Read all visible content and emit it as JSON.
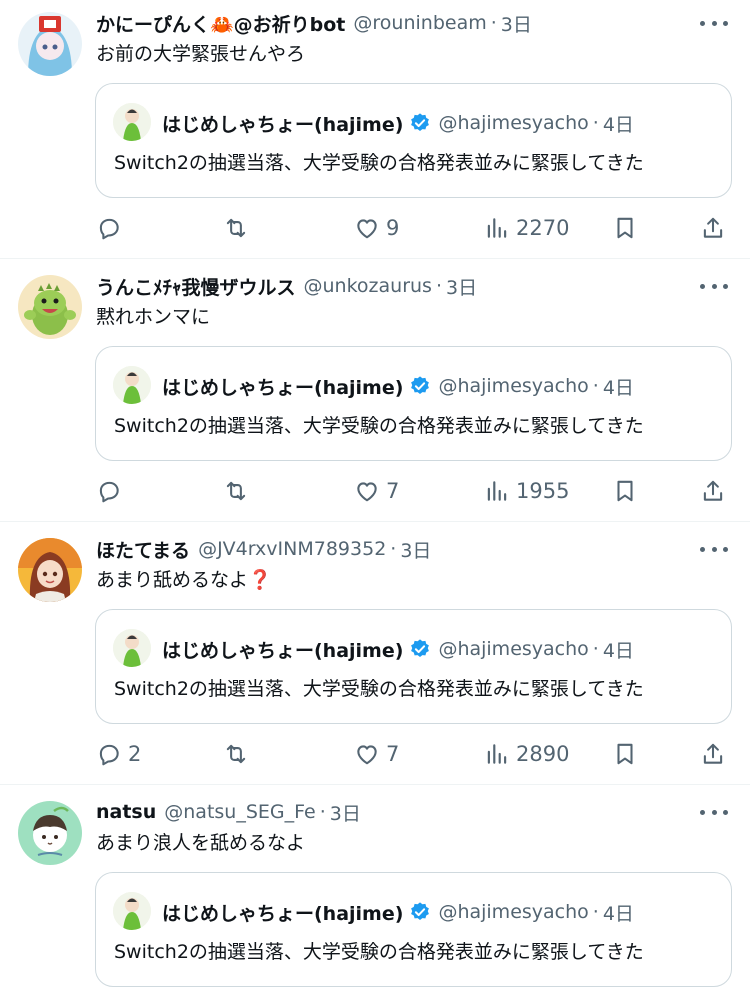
{
  "posts": [
    {
      "author": "かにーぴんく🦀@お祈りbot",
      "handle": "@rouninbeam",
      "time": "3日",
      "text": "お前の大学緊張せんやろ",
      "quote": {
        "author": "はじめしゃちょー(hajime)",
        "handle": "@hajimesyacho",
        "time": "4日",
        "text": "Switch2の抽選当落、大学受験の合格発表並みに緊張してきた"
      },
      "replies": "",
      "likes": "9",
      "views": "2270"
    },
    {
      "author": "うんこﾒﾁｬ我慢ザウルス",
      "handle": "@unkozaurus",
      "time": "3日",
      "text": "黙れホンマに",
      "quote": {
        "author": "はじめしゃちょー(hajime)",
        "handle": "@hajimesyacho",
        "time": "4日",
        "text": "Switch2の抽選当落、大学受験の合格発表並みに緊張してきた"
      },
      "replies": "",
      "likes": "7",
      "views": "1955"
    },
    {
      "author": "ほたてまる",
      "handle": "@JV4rxvINM789352",
      "time": "3日",
      "text": "あまり舐めるなよ❓",
      "quote": {
        "author": "はじめしゃちょー(hajime)",
        "handle": "@hajimesyacho",
        "time": "4日",
        "text": "Switch2の抽選当落、大学受験の合格発表並みに緊張してきた"
      },
      "replies": "2",
      "likes": "7",
      "views": "2890"
    },
    {
      "author": "natsu",
      "handle": "@natsu_SEG_Fe",
      "time": "3日",
      "text": "あまり浪人を舐めるなよ",
      "quote": {
        "author": "はじめしゃちょー(hajime)",
        "handle": "@hajimesyacho",
        "time": "4日",
        "text": "Switch2の抽選当落、大学受験の合格発表並みに緊張してきた"
      }
    }
  ],
  "separator": "·",
  "icons": {
    "reply": "reply-icon",
    "repost": "repost-icon",
    "like": "like-icon",
    "views": "views-icon",
    "bookmark": "bookmark-icon",
    "share": "share-icon",
    "more": "more-icon",
    "verified": "verified-badge-icon"
  },
  "colors": {
    "text": "#0f1419",
    "secondary": "#536471",
    "border": "#cfd9de",
    "divider": "#eff3f4",
    "verified": "#1d9bf0"
  }
}
